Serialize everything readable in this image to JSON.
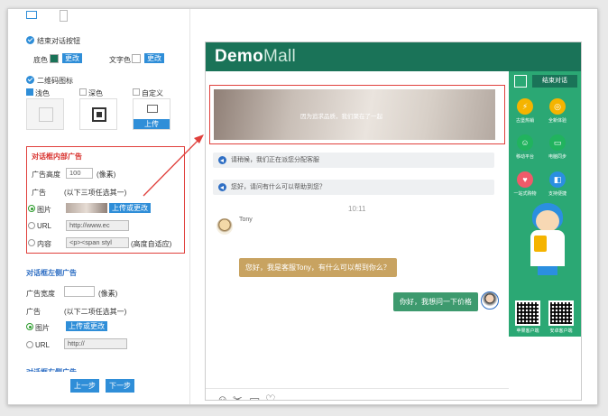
{
  "left_panel": {
    "end_dialog_label": "结束对话按钮",
    "bg_color_label": "底色",
    "text_color_label": "文字色",
    "change_label": "更改",
    "qr_icon_label": "二维码图标",
    "qr_styles": [
      "浅色",
      "深色",
      "自定义"
    ],
    "upload_label": "上传",
    "inner_ad": {
      "title": "对话框内部广告",
      "height_label": "广告高度",
      "height_value": "100",
      "height_unit": "(像素)",
      "ad_label": "广告",
      "ad_hint": "(以下三项任选其一)",
      "image_option": "图片",
      "upload_change": "上传或更改",
      "url_option": "URL",
      "url_value": "http://www.ec",
      "content_option": "内容",
      "content_value": "<p><span styl",
      "content_hint": "(高度自适应)"
    },
    "left_ad": {
      "title": "对话框左侧广告",
      "width_label": "广告宽度",
      "width_value": "",
      "width_unit": "(像素)",
      "ad_label": "广告",
      "ad_hint": "(以下二项任选其一)",
      "image_option": "图片",
      "upload_change": "上传或更改",
      "url_option": "URL",
      "url_value": "http://"
    },
    "right_ad_title": "对话框右侧广告",
    "prev_label": "上一步",
    "next_label": "下一步"
  },
  "preview": {
    "logo_demo": "Demo",
    "logo_mall": "Mall",
    "banner_text": "因为追求品质，我们聚在了一起",
    "sys_msg_1": "请稍候，我们正在派您分配客服",
    "sys_msg_2": "您好，请问有什么可以帮助到您？",
    "time": "10:11",
    "agent_name": "Tony",
    "agent_msg": "您好，我是客服Tony，有什么可以帮到你么？",
    "user_msg": "你好，我想问一下价格",
    "end_chat_label": "结束对话",
    "side_items": [
      {
        "label": "古堡热销",
        "icon": "⚡",
        "color": "#f5b400"
      },
      {
        "label": "全新体验",
        "icon": "◎",
        "color": "#f5b400"
      },
      {
        "label": "移动平台",
        "icon": "☺",
        "color": "#21b35e"
      },
      {
        "label": "电脑同步",
        "icon": "▭",
        "color": "#21b35e"
      },
      {
        "label": "一站式购物",
        "icon": "♥",
        "color": "#f05a6a"
      },
      {
        "label": "支持便捷",
        "icon": "◧",
        "color": "#2b8fe0"
      }
    ],
    "qr_labels": [
      "苹果客户端",
      "安卓客户端"
    ],
    "close_label": "关闭",
    "send_label": "发送"
  },
  "colors": {
    "brand_green": "#1a7358",
    "sidebar_green": "#2ba874",
    "accent_blue": "#2f8ed8",
    "highlight_red": "#e0403c"
  }
}
